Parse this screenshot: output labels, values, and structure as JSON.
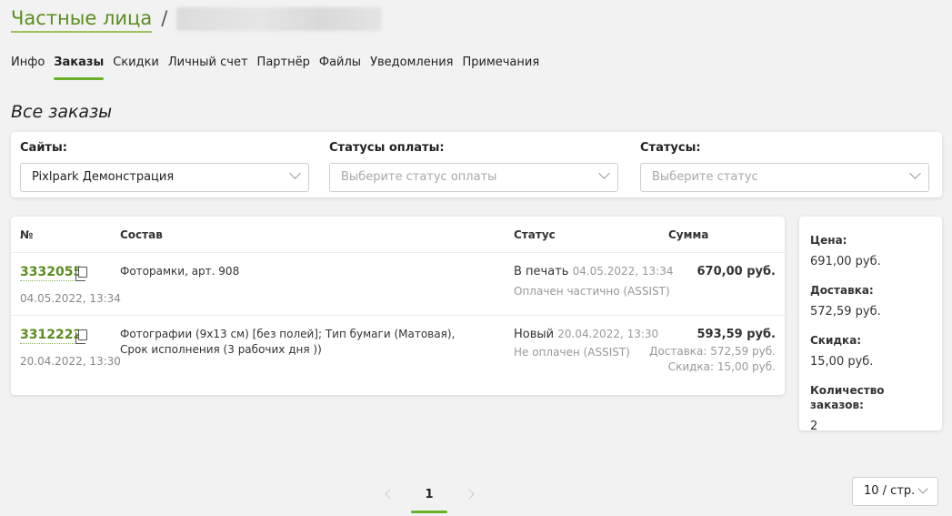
{
  "breadcrumb": {
    "parent": "Частные лица",
    "separator": "/"
  },
  "tabs": [
    {
      "label": "Инфо",
      "active": false
    },
    {
      "label": "Заказы",
      "active": true
    },
    {
      "label": "Скидки",
      "active": false
    },
    {
      "label": "Личный счет",
      "active": false
    },
    {
      "label": "Партнёр",
      "active": false
    },
    {
      "label": "Файлы",
      "active": false
    },
    {
      "label": "Уведомления",
      "active": false
    },
    {
      "label": "Примечания",
      "active": false
    }
  ],
  "section_title": "Все заказы",
  "filters": {
    "sites": {
      "label": "Сайты:",
      "value": "Pixlpark Демонстрация"
    },
    "payment_status": {
      "label": "Статусы оплаты:",
      "placeholder": "Выберите статус оплаты"
    },
    "status": {
      "label": "Статусы:",
      "placeholder": "Выберите статус"
    }
  },
  "table": {
    "columns": {
      "number": "№",
      "composition": "Состав",
      "status": "Статус",
      "sum": "Сумма"
    },
    "rows": [
      {
        "number": "3332055",
        "date": "04.05.2022, 13:34",
        "composition": "Фоторамки, арт. 908",
        "status": "В печать",
        "status_date": "04.05.2022, 13:34",
        "payment": "Оплачен частично (ASSIST)",
        "sum": "670,00 руб."
      },
      {
        "number": "3312222",
        "date": "20.04.2022, 13:30",
        "composition": "Фотографии (9х13 см) [без полей]; Тип бумаги (Матовая), Срок исполнения (3 рабочих дня ))",
        "status": "Новый",
        "status_date": "20.04.2022, 13:30",
        "payment": "Не оплачен (ASSIST)",
        "sum": "593,59 руб.",
        "delivery": "Доставка: 572,59 руб.",
        "discount": "Скидка: 15,00 руб."
      }
    ]
  },
  "summary": {
    "price_label": "Цена:",
    "price": "691,00 руб.",
    "delivery_label": "Доставка:",
    "delivery": "572,59 руб.",
    "discount_label": "Скидка:",
    "discount": "15,00 руб.",
    "count_label": "Количество заказов:",
    "count": "2"
  },
  "pagination": {
    "current_page": "1",
    "per_page": "10 / стр."
  },
  "colors": {
    "accent": "#6bb22b",
    "link": "#5a8d1f"
  }
}
